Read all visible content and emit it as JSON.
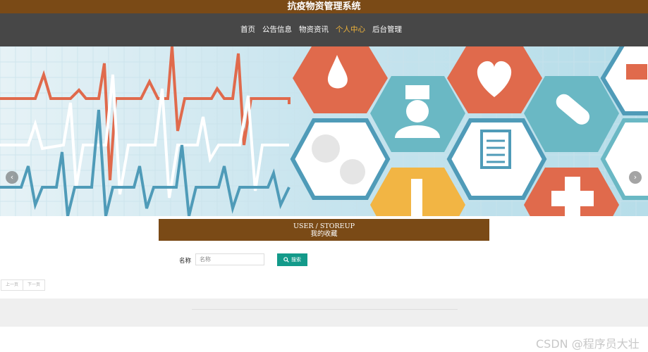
{
  "header": {
    "title": "抗疫物资管理系统"
  },
  "nav": {
    "items": [
      {
        "label": "首页",
        "active": false
      },
      {
        "label": "公告信息",
        "active": false
      },
      {
        "label": "物资资讯",
        "active": false
      },
      {
        "label": "个人中心",
        "active": true
      },
      {
        "label": "后台管理",
        "active": false
      }
    ],
    "active_color": "#f2b53a"
  },
  "banner": {
    "prev_icon": "chevron-left-icon",
    "next_icon": "chevron-right-icon",
    "slide_count": 3,
    "active_slide": 1
  },
  "section": {
    "title_en": "USER / STOREUP",
    "title_cn": "我的收藏"
  },
  "search": {
    "label": "名称",
    "placeholder": "名称",
    "value": "",
    "button_label": "搜索",
    "button_icon": "search-icon"
  },
  "pagination": {
    "prev_label": "上一页",
    "next_label": "下一页"
  },
  "watermark": "CSDN @程序员大壮",
  "colors": {
    "brand": "#7a4a16",
    "nav_bg": "#474747",
    "button": "#139a8a",
    "footer_bg": "#efefef"
  }
}
